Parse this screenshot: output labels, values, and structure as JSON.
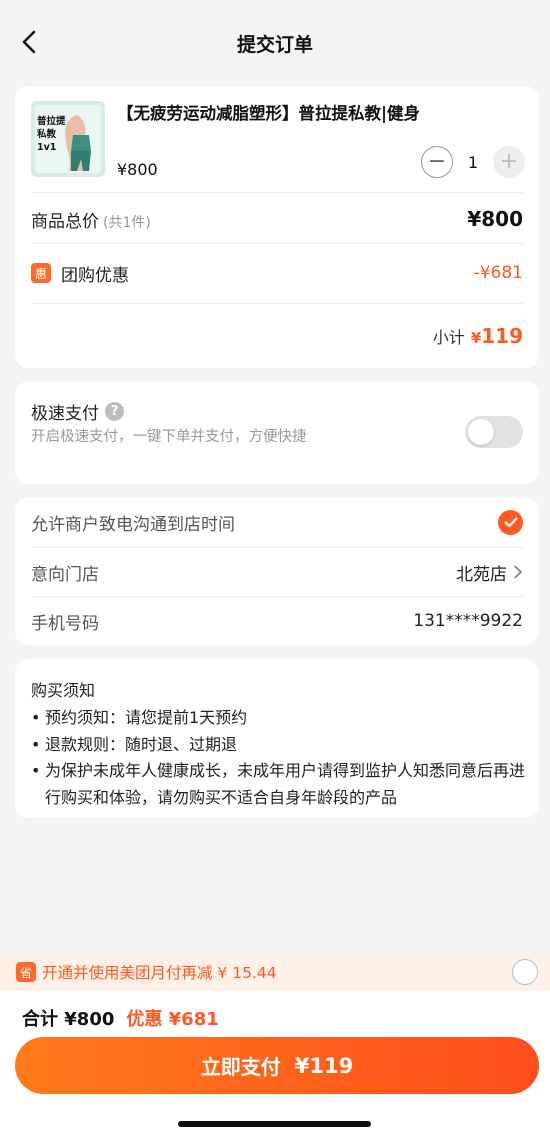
{
  "nav": {
    "title": "提交订单"
  },
  "product": {
    "thumb_text": "普拉提私教1v1",
    "name": "【无疲劳运动减脂塑形】普拉提私教|健身",
    "price": "¥800",
    "quantity": "1",
    "minus": "−",
    "plus": "+"
  },
  "summary": {
    "total_label": "商品总价",
    "total_count": "(共1件)",
    "total_value": "¥800",
    "discount_badge": "惠",
    "discount_label": "团购优惠",
    "discount_value": "-¥681",
    "subtotal_label": "小计",
    "subtotal_currency": "¥",
    "subtotal_value": "119"
  },
  "express": {
    "title": "极速支付",
    "help": "?",
    "description": "开启极速支付，一键下单并支付，方便快捷",
    "enabled": false
  },
  "merchant": {
    "allow_call_label": "允许商户致电沟通到店时间",
    "allow_call_checked": true,
    "store_label": "意向门店",
    "store_value": "北苑店",
    "phone_label": "手机号码",
    "phone_value": "131****9922"
  },
  "notice": {
    "title": "购买须知",
    "items": [
      "预约须知：请您提前1天预约",
      "退款规则：随时退、过期退",
      "为保护未成年人健康成长，未成年用户请得到监护人知悉同意后再进行购买和体验，请勿购买不适合自身年龄段的产品"
    ]
  },
  "promo": {
    "badge": "省",
    "text": "开通并使用美团月付再减 ¥ 15.44",
    "selected": false
  },
  "footer": {
    "total": "合计 ¥800",
    "discount": "优惠 ¥681",
    "pay_label": "立即支付",
    "pay_amount": "¥119"
  },
  "colors": {
    "accent": "#ff5a23",
    "background": "#f4f4f4"
  }
}
